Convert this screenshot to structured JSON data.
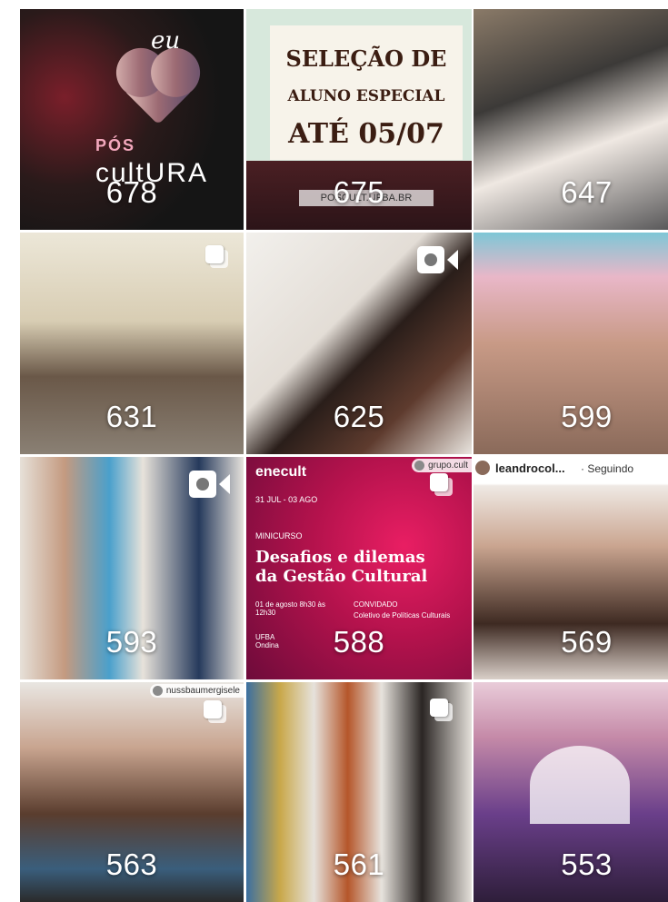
{
  "tiles": [
    {
      "count": "678",
      "badge": "none",
      "eu": "eu",
      "pos": "PÓS",
      "cult": "cultURA"
    },
    {
      "count": "675",
      "badge": "none",
      "line1": "SELEÇÃO DE",
      "line2": "ALUNO ESPECIAL",
      "line3": "ATÉ 05/07",
      "foot": "POSCULT.UFBA.BR"
    },
    {
      "count": "647",
      "badge": "none"
    },
    {
      "count": "631",
      "badge": "multi"
    },
    {
      "count": "625",
      "badge": "video"
    },
    {
      "count": "599",
      "badge": "none"
    },
    {
      "count": "593",
      "badge": "video"
    },
    {
      "count": "588",
      "badge": "multi",
      "tag": "grupo.cult"
    },
    {
      "count": "569",
      "badge": "none",
      "user": "leandrocol...",
      "follow": "· Seguindo"
    },
    {
      "count": "563",
      "badge": "multi",
      "tag": "nussbaumergisele"
    },
    {
      "count": "561",
      "badge": "multi"
    },
    {
      "count": "553",
      "badge": "none"
    }
  ],
  "enecult": {
    "title": "enecult",
    "dates": "31 JUL - 03 AGO",
    "type": "MINICURSO",
    "heading": "Desafios e dilemas da Gestão Cultural",
    "when": "01 de agosto 8h30 às 12h30",
    "guest_label": "CONVIDADO",
    "guest": "Coletivo de Políticas Culturais",
    "place": "UFBA Ondina"
  },
  "colors": {
    "count_text": "#ffffff",
    "enecult_bg": "#c2185b"
  }
}
